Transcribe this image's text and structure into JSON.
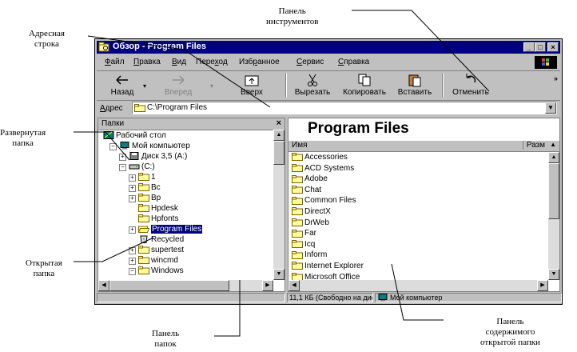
{
  "callouts": {
    "toolbar_panel": [
      "Панель",
      "инструментов"
    ],
    "address_bar": [
      "Адресная",
      "строка"
    ],
    "expanded_folder": [
      "Развернутая",
      "папка"
    ],
    "open_folder": [
      "Открытая",
      "папка"
    ],
    "folders_panel": [
      "Панель",
      "папок"
    ],
    "content_panel": [
      "Панель",
      "содержимого",
      "открытой папки"
    ]
  },
  "window": {
    "title": "Обзор - Program Files",
    "controls": [
      "_",
      "□",
      "×"
    ]
  },
  "menu": [
    {
      "u": "Ф",
      "rest": "айл"
    },
    {
      "u": "П",
      "rest": "равка"
    },
    {
      "u": "В",
      "rest": "ид",
      "pre": ""
    },
    {
      "pre": "Пере",
      "u": "х",
      "rest": "од"
    },
    {
      "pre": "Изб",
      "u": "р",
      "rest": "анное"
    },
    {
      "u": "С",
      "rest": "ервис"
    },
    {
      "u": "С",
      "rest": "правка"
    }
  ],
  "toolbar": {
    "back": "Назад",
    "forward": "Вперед",
    "up": "Вверх",
    "cut": "Вырезать",
    "copy": "Копировать",
    "paste": "Вставить",
    "undo": "Отменить",
    "more": "»"
  },
  "address": {
    "label_u": "А",
    "label_rest": "дрес",
    "value": "C:\\Program Files"
  },
  "left_pane": {
    "header": "Папки",
    "close": "×",
    "tree": [
      {
        "label": "Рабочий стол",
        "level": 0,
        "icon": "desktop-icon"
      },
      {
        "label": "Мой компьютер",
        "level": 1,
        "icon": "computer-icon",
        "pm": "−"
      },
      {
        "label": "Диск 3,5 (A:)",
        "level": 2,
        "icon": "floppy-icon",
        "pm": "+"
      },
      {
        "label": "(C:)",
        "level": 2,
        "icon": "drive-icon",
        "pm": "−"
      },
      {
        "label": "1",
        "level": 3,
        "icon": "folder-icon",
        "pm": "+"
      },
      {
        "label": "Bc",
        "level": 3,
        "icon": "folder-icon",
        "pm": "+"
      },
      {
        "label": "Bp",
        "level": 3,
        "icon": "folder-icon",
        "pm": "+"
      },
      {
        "label": "Hpdesk",
        "level": 3,
        "icon": "folder-icon"
      },
      {
        "label": "Hpfonts",
        "level": 3,
        "icon": "folder-icon"
      },
      {
        "label": "Program Files",
        "level": 3,
        "icon": "open-folder-icon",
        "pm": "+",
        "selected": true
      },
      {
        "label": "Recycled",
        "level": 3,
        "icon": "recycle-bin-icon"
      },
      {
        "label": "supertest",
        "level": 3,
        "icon": "folder-icon",
        "pm": "+"
      },
      {
        "label": "wincmd",
        "level": 3,
        "icon": "folder-icon",
        "pm": "+"
      },
      {
        "label": "Windows",
        "level": 3,
        "icon": "folder-icon",
        "pm": "−"
      }
    ]
  },
  "right_pane": {
    "title": "Program Files",
    "col_name": "Имя",
    "col_size": "Разм",
    "files": [
      "Accessories",
      "ACD Systems",
      "Adobe",
      "Chat",
      "Common Files",
      "DirectX",
      "DrWeb",
      "Far",
      "Icq",
      "Inform",
      "Internet Explorer",
      "Microsoft Office"
    ]
  },
  "status": {
    "size": "11,1 КБ (Свободно на дис",
    "location": "Мой компьютер"
  },
  "colors": {
    "title_bar": "#000080",
    "selection": "#000080",
    "folder": "#ffff99",
    "chrome": "#c0c0c0"
  }
}
